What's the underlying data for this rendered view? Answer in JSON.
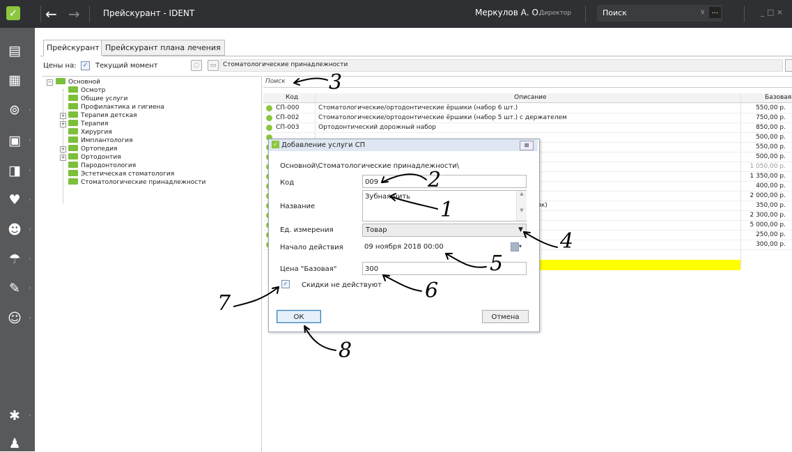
{
  "window": {
    "title": "Прейскурант - IDENT",
    "user_name": "Меркулов А. О.",
    "user_role": "Директор",
    "search_placeholder": "Поиск",
    "search_more": "...",
    "controls": "_ □ ×"
  },
  "tabs": [
    "Прейскурант",
    "Прейскурант плана лечения"
  ],
  "toolbar": {
    "prices_label": "Цены на:",
    "current_moment": "Текущий момент",
    "current_moment_checked": true,
    "path": "Стоматологические принадлежности"
  },
  "tree": {
    "root": "Основной",
    "items": [
      "Осмотр",
      "Общие услуги",
      "Профилактика и гигиена",
      "Терапия детская",
      "Терапия",
      "Хирургия",
      "Имплантология",
      "Ортопедия",
      "Ортодонтия",
      "Пародонтология",
      "Эстетическая стоматология",
      "Стоматологические принадлежности"
    ]
  },
  "grid": {
    "search_placeholder": "Поиск",
    "columns": [
      "Код",
      "Описание",
      "Базовая"
    ],
    "rows": [
      {
        "code": "СП-000",
        "description": "Стоматологические/ортодонтические ёршики (набор 6 шт.)",
        "price": "550,00 р."
      },
      {
        "code": "СП-002",
        "description": "Стоматологические/ортодонтические ёршики (набор 5 шт.) с держателем",
        "price": "750,00 р."
      },
      {
        "code": "СП-003",
        "description": "Ортодонтический дорожный набор",
        "price": "850,00 р."
      },
      {
        "code": "",
        "description": "",
        "price": "500,00 р."
      },
      {
        "code": "",
        "description": "",
        "price": "550,00 р."
      },
      {
        "code": "",
        "description": "",
        "price": "500,00 р."
      },
      {
        "code": "",
        "description": "",
        "price": "1 050,00 р."
      },
      {
        "code": "",
        "description": "",
        "price": "1 350,00 р."
      },
      {
        "code": "",
        "description": "",
        "price": "400,00 р."
      },
      {
        "code": "",
        "description": "",
        "price": "2 000,00 р."
      },
      {
        "code": "",
        "description": "ик)",
        "price": "350,00 р."
      },
      {
        "code": "",
        "description": "",
        "price": "2 300,00 р."
      },
      {
        "code": "",
        "description": "",
        "price": "5 000,00 р."
      },
      {
        "code": "",
        "description": "",
        "price": "250,00 р."
      },
      {
        "code": "",
        "description": "",
        "price": "300,00 р."
      }
    ]
  },
  "dialog": {
    "title": "Добавление услуги СП",
    "close": "⊠",
    "path": "Основной\\Стоматологические принадлежности\\",
    "code_label": "Код",
    "code_value": "009",
    "name_label": "Название",
    "name_value": "Зубная нить",
    "unit_label": "Ед. измерения",
    "unit_value": "Товар",
    "start_label": "Начало действия",
    "start_value": "09  ноября  2018 00:00",
    "price_label": "Цена \"Базовая\"",
    "price_value": "300",
    "no_discount_label": "Скидки не действуют",
    "no_discount_checked": true,
    "ok": "ОК",
    "cancel": "Отмена"
  },
  "annotations": [
    "1",
    "2",
    "3",
    "4",
    "5",
    "6",
    "7",
    "8"
  ]
}
